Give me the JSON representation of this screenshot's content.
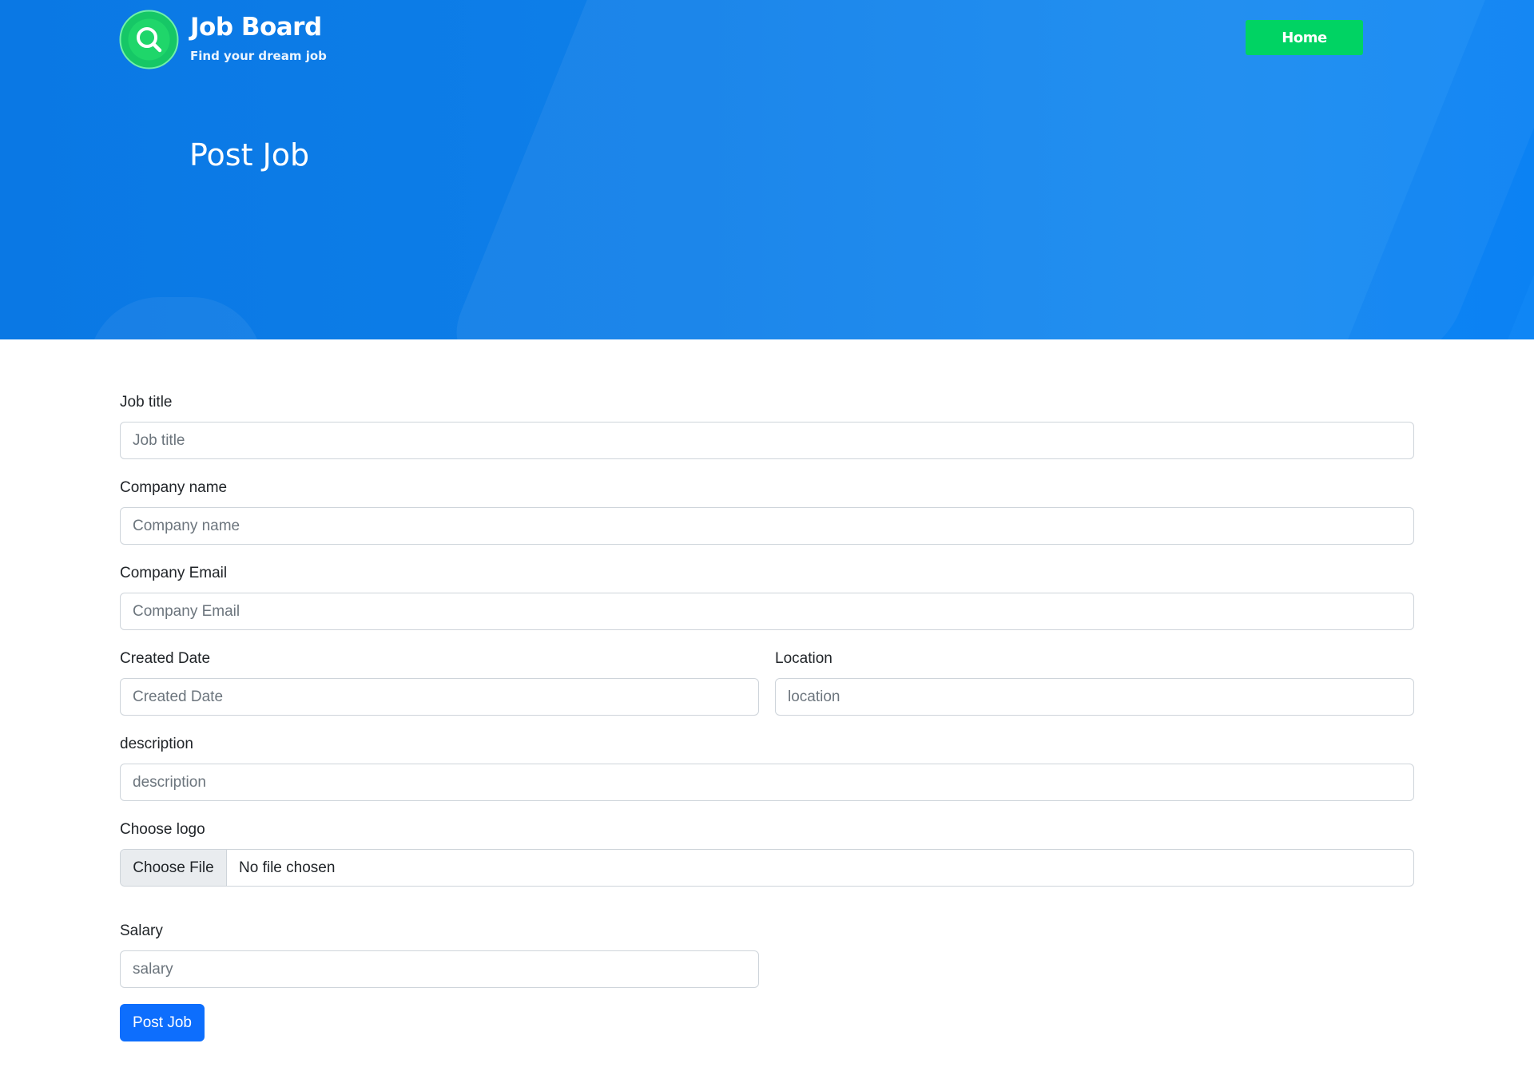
{
  "header": {
    "brand_title": "Job Board",
    "brand_subtitle": "Find your dream job",
    "home_label": "Home",
    "page_title": "Post Job"
  },
  "form": {
    "job_title": {
      "label": "Job title",
      "placeholder": "Job title",
      "value": ""
    },
    "company_name": {
      "label": "Company name",
      "placeholder": "Company name",
      "value": ""
    },
    "company_email": {
      "label": "Company Email",
      "placeholder": "Company Email",
      "value": ""
    },
    "created_date": {
      "label": "Created Date",
      "placeholder": "Created Date",
      "value": ""
    },
    "location": {
      "label": "Location",
      "placeholder": "location",
      "value": ""
    },
    "description": {
      "label": "description",
      "placeholder": "description",
      "value": ""
    },
    "logo": {
      "label": "Choose logo",
      "button_label": "Choose File",
      "status": "No file chosen"
    },
    "salary": {
      "label": "Salary",
      "placeholder": "salary",
      "value": ""
    },
    "submit_label": "Post Job"
  },
  "colors": {
    "hero_blue": "#0a78e4",
    "home_green": "#00d363",
    "primary_blue": "#0d6efd",
    "logo_green": "#1fd66a"
  },
  "icons": {
    "logo": "magnifier-in-circle-icon"
  }
}
